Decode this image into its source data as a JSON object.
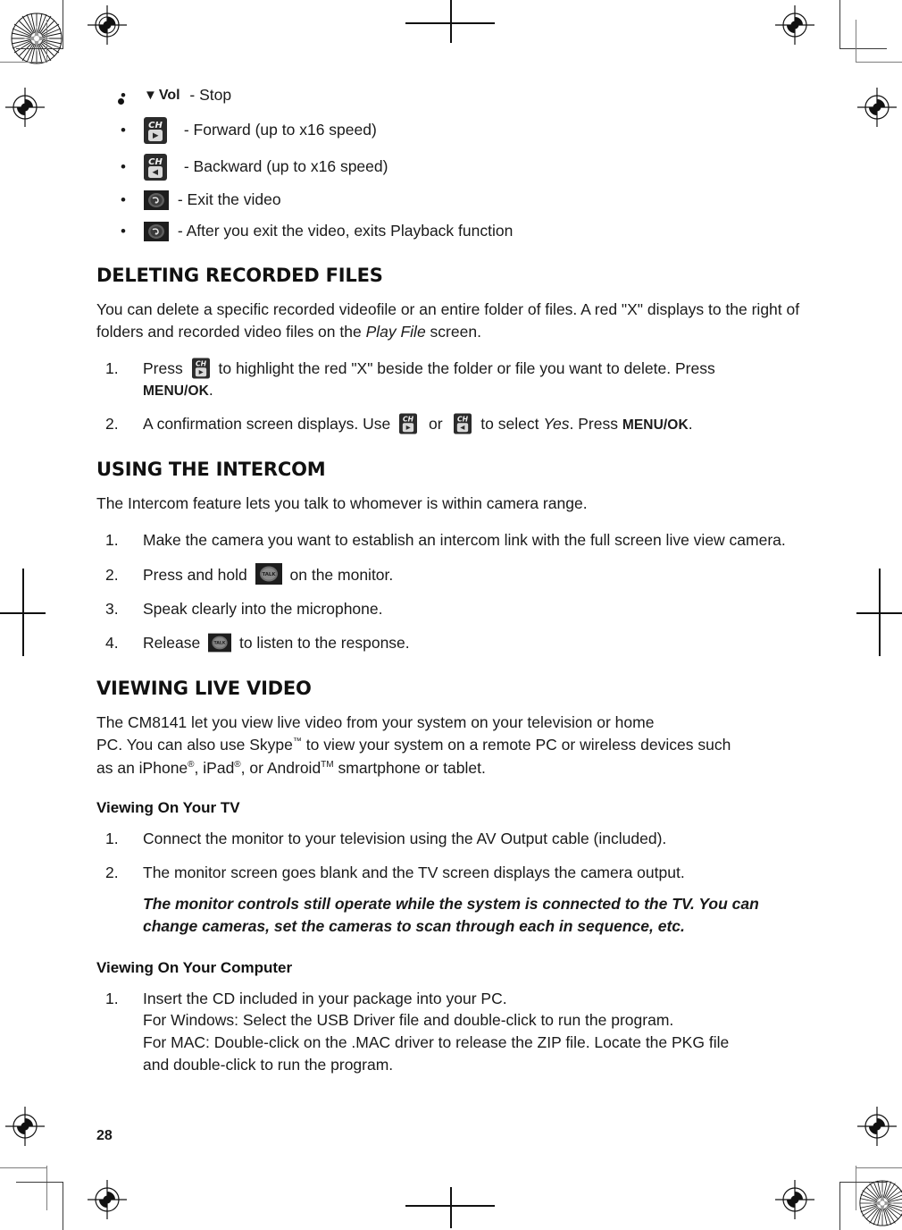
{
  "page": {
    "number": "28"
  },
  "playback_bullets": [
    {
      "bullet": "•",
      "icon": "vol-down-key-icon",
      "prefix_triangle": "▼",
      "prefix_label": "Vol",
      "text": " - Stop"
    },
    {
      "bullet": "•",
      "icon": "ch-forward-key-icon",
      "text": " - Forward (up to x16 speed)"
    },
    {
      "bullet": "•",
      "icon": "ch-backward-key-icon",
      "text": " - Backward (up to x16 speed)"
    },
    {
      "bullet": "•",
      "icon": "exit-key-icon",
      "text": " - Exit the video"
    },
    {
      "bullet": "•",
      "icon": "exit-key-icon",
      "text": " - After you exit the video, exits Playback function"
    }
  ],
  "deleting": {
    "heading": "DELETING RECORDED FILES",
    "intro_part1": "You can delete a specific recorded videofile or an entire folder of files. A red \"X\" displays to the right of folders and recorded video files on the ",
    "intro_italic": "Play File",
    "intro_part2": " screen.",
    "steps": [
      {
        "num": "1.",
        "pre": "Press",
        "icon": "ch-forward-key-icon",
        "mid": "to highlight the red \"X\" beside the folder or file you want to delete. Press ",
        "button": "MENU/OK",
        "post": "."
      },
      {
        "num": "2.",
        "pre": "A confirmation screen displays. Use",
        "icon1": "ch-forward-key-icon",
        "conj": "or",
        "icon2": "ch-backward-key-icon",
        "mid": "to select ",
        "italic": "Yes",
        "mid2": ". Press ",
        "button": "MENU/OK",
        "post": "."
      }
    ]
  },
  "intercom": {
    "heading": "USING THE INTERCOM",
    "intro": "The Intercom feature lets you talk to whomever is within camera range.",
    "steps": [
      {
        "num": "1.",
        "text": "Make the camera you want to establish an intercom link with the full screen live view camera."
      },
      {
        "num": "2.",
        "pre": "Press and hold",
        "icon": "talk-key-icon",
        "post": "on the monitor."
      },
      {
        "num": "3.",
        "text": "Speak clearly into the microphone."
      },
      {
        "num": "4.",
        "pre": "Release",
        "icon": "talk-key-icon",
        "post": "to listen to the response."
      }
    ]
  },
  "live_video": {
    "heading": "VIEWING LIVE VIDEO",
    "paragraph_a": "The  CM8141 let you view live video from your system on your television or home",
    "paragraph_b_1": "PC. You can also use Skype",
    "paragraph_b_tm": "™",
    "paragraph_b_2": " to view your system on a remote PC or wireless devices such",
    "paragraph_c_1": "as an iPhone",
    "paragraph_c_reg1": "®",
    "paragraph_c_2": ", iPad",
    "paragraph_c_reg2": "®",
    "paragraph_c_3": ", or Android",
    "paragraph_c_tm": "TM",
    "paragraph_c_4": " smartphone or tablet.",
    "tv": {
      "subheading": "Viewing On Your TV",
      "steps": [
        {
          "num": "1.",
          "text": "Connect the monitor to your television using the AV Output cable (included)."
        },
        {
          "num": "2.",
          "text": "The monitor screen goes blank and the TV screen displays the camera output."
        }
      ],
      "note_line1": "The monitor controls still operate while the system is connected to the TV. You can",
      "note_line2": "change cameras, set the cameras to scan through each in sequence, etc."
    },
    "computer": {
      "subheading": "Viewing On Your Computer",
      "steps": [
        {
          "num": "1.",
          "line1": "Insert the CD included in your package into your PC.",
          "line2": "For Windows:  Select the USB Driver file and double-click to run the program.",
          "line3": "For MAC:  Double-click on the .MAC driver to release the ZIP file. Locate the PKG file",
          "line4": "and double-click to run the program."
        }
      ]
    }
  },
  "icons": {
    "ch_label": "CH",
    "talk_label": "TALK"
  },
  "colors": {
    "text": "#1a1a1a",
    "key_dark": "#2b2b2b",
    "key_gray": "#6e6e6e",
    "cropmark": "#7d7d7d"
  }
}
